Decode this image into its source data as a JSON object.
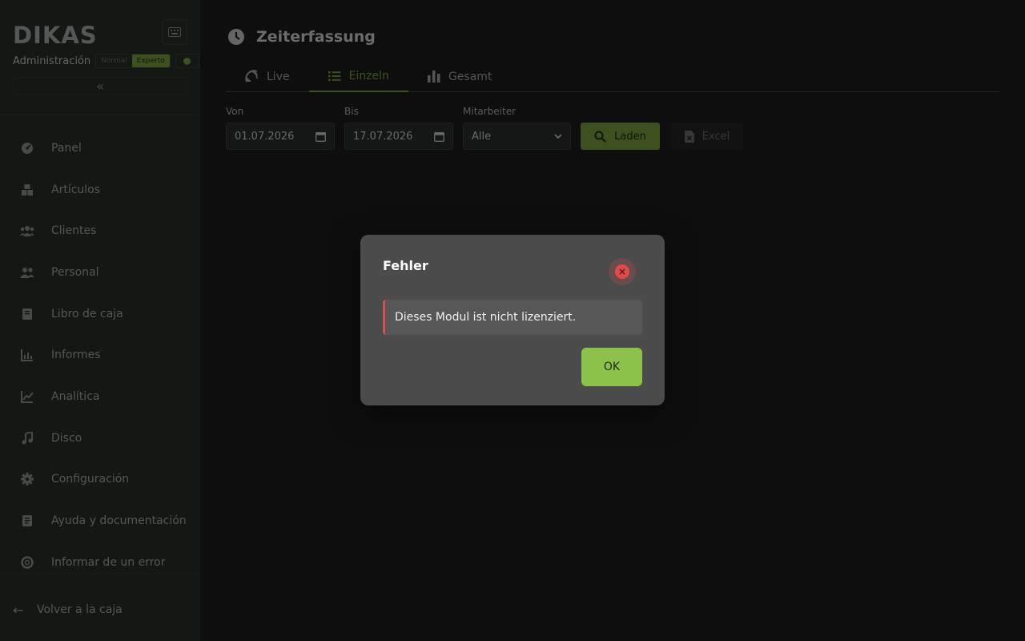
{
  "app": {
    "logo_text": "DIKAS",
    "admin_label": "Administración",
    "mode_normal": "Normal",
    "mode_expert": "Experto"
  },
  "sidebar": {
    "items": [
      {
        "label": "Panel",
        "icon": "dashboard-icon"
      },
      {
        "label": "Artículos",
        "icon": "boxes-icon"
      },
      {
        "label": "Clientes",
        "icon": "customers-icon"
      },
      {
        "label": "Personal",
        "icon": "staff-icon"
      },
      {
        "label": "Libro de caja",
        "icon": "book-icon"
      },
      {
        "label": "Informes",
        "icon": "report-chart-icon"
      },
      {
        "label": "Analítica",
        "icon": "analytics-icon"
      },
      {
        "label": "Disco",
        "icon": "music-note-icon"
      },
      {
        "label": "Configuración",
        "icon": "gear-icon"
      },
      {
        "label": "Ayuda y documentación",
        "icon": "document-icon"
      },
      {
        "label": "Informar de un error",
        "icon": "lifebuoy-icon"
      }
    ],
    "back_label": "Volver a la caja"
  },
  "page": {
    "title": "Zeiterfassung",
    "tabs": [
      {
        "label": "Live",
        "active": false
      },
      {
        "label": "Einzeln",
        "active": true
      },
      {
        "label": "Gesamt",
        "active": false
      }
    ]
  },
  "filters": {
    "from_label": "Von",
    "from_value": "01.07.2026",
    "to_label": "Bis",
    "to_value": "17.07.2026",
    "employee_label": "Mitarbeiter",
    "employee_value": "Alle",
    "load_label": "Laden",
    "excel_label": "Excel"
  },
  "dialog": {
    "title": "Fehler",
    "message": "Dieses Modul ist nicht lizenziert.",
    "ok_label": "OK"
  },
  "colors": {
    "accent": "#7aa33e",
    "ok_button": "#8bc34a",
    "error": "#e24a4a"
  }
}
